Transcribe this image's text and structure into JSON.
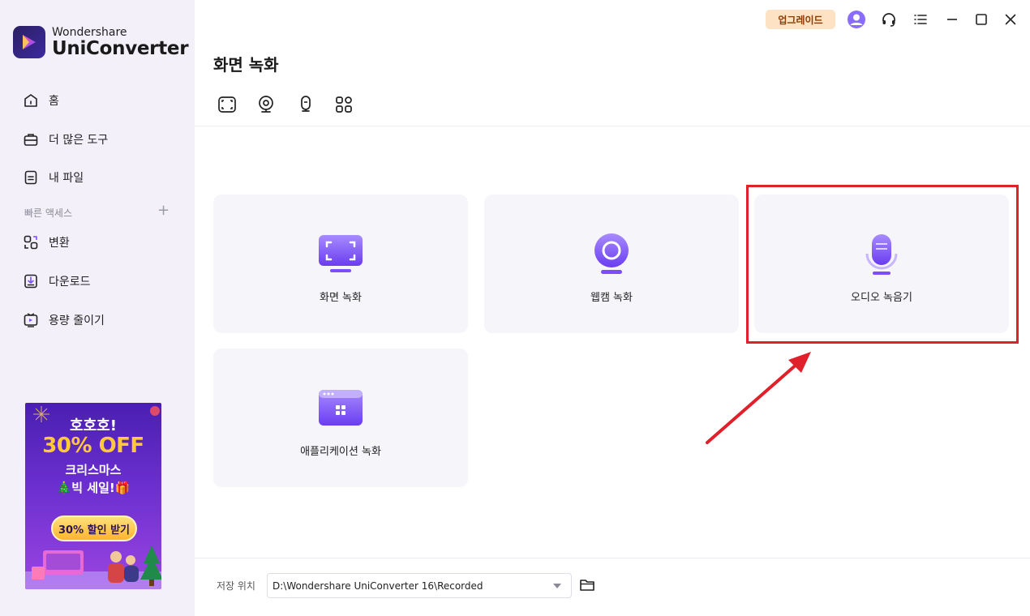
{
  "app": {
    "brand_line1": "Wondershare",
    "brand_line2": "UniConverter",
    "accent": "#7b4dff"
  },
  "titlebar": {
    "upgrade_label": "업그레이드",
    "icons": [
      "avatar-icon",
      "headset-icon",
      "menu-icon",
      "minimize-icon",
      "maximize-icon",
      "close-icon"
    ]
  },
  "sidebar": {
    "items": [
      {
        "label": "홈",
        "icon": "home-icon"
      },
      {
        "label": "더 많은 도구",
        "icon": "toolbox-icon"
      },
      {
        "label": "내 파일",
        "icon": "file-icon"
      }
    ],
    "quick_access_label": "빠른 액세스",
    "quick_items": [
      {
        "label": "변환",
        "icon": "convert-icon"
      },
      {
        "label": "다운로드",
        "icon": "download-icon"
      },
      {
        "label": "용량 줄이기",
        "icon": "compress-icon"
      }
    ]
  },
  "promo": {
    "line1": "호호호!",
    "line2": "30% OFF",
    "line3": "크리스마스",
    "line4": "🎄빅 세일!🎁",
    "button": "30% 할인 받기"
  },
  "main": {
    "title": "화면 녹화",
    "toolbar_icons": [
      "screen-record-icon",
      "webcam-icon",
      "audio-icon",
      "apps-icon"
    ],
    "cards": [
      {
        "label": "화면 녹화",
        "icon": "screen-card-icon"
      },
      {
        "label": "웹캠 녹화",
        "icon": "webcam-card-icon"
      },
      {
        "label": "오디오 녹음기",
        "icon": "microphone-card-icon"
      },
      {
        "label": "애플리케이션 녹화",
        "icon": "application-card-icon"
      }
    ]
  },
  "footer": {
    "save_label": "저장 위치",
    "save_path": "D:\\Wondershare UniConverter 16\\Recorded"
  },
  "annotation": {
    "highlight_color": "#e0202a"
  }
}
